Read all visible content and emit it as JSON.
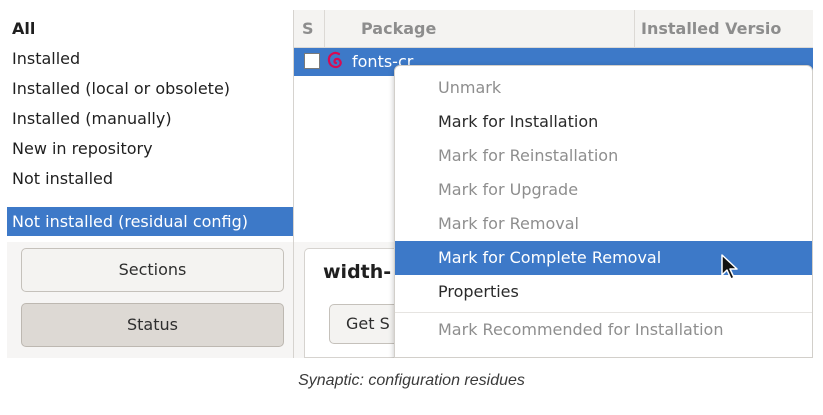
{
  "filters": {
    "items": [
      {
        "label": "All",
        "bold": true,
        "selected": false
      },
      {
        "label": "Installed",
        "bold": false,
        "selected": false
      },
      {
        "label": "Installed (local or obsolete)",
        "bold": false,
        "selected": false
      },
      {
        "label": "Installed (manually)",
        "bold": false,
        "selected": false
      },
      {
        "label": "New in repository",
        "bold": false,
        "selected": false
      },
      {
        "label": "Not installed",
        "bold": false,
        "selected": false
      },
      {
        "label": "Not installed (residual config)",
        "bold": false,
        "selected": true
      }
    ]
  },
  "panel_buttons": {
    "sections": "Sections",
    "status": "Status"
  },
  "package_list": {
    "columns": {
      "s": "S",
      "package": "Package",
      "installed_version": "Installed Versio"
    },
    "row": {
      "name": "fonts-cr",
      "checked": false,
      "icon": "debian-swirl-icon"
    }
  },
  "detail": {
    "title": "width-",
    "button": "Get S"
  },
  "context_menu": {
    "items": [
      {
        "label": "Unmark",
        "enabled": false,
        "highlighted": false
      },
      {
        "label": "Mark for Installation",
        "enabled": true,
        "highlighted": false
      },
      {
        "label": "Mark for Reinstallation",
        "enabled": false,
        "highlighted": false
      },
      {
        "label": "Mark for Upgrade",
        "enabled": false,
        "highlighted": false
      },
      {
        "label": "Mark for Removal",
        "enabled": false,
        "highlighted": false
      },
      {
        "label": "Mark for Complete Removal",
        "enabled": true,
        "highlighted": true
      },
      {
        "label": "Properties",
        "enabled": true,
        "highlighted": false
      },
      {
        "label": "Mark Recommended for Installation",
        "enabled": false,
        "highlighted": false
      }
    ]
  },
  "caption": "Synaptic: configuration residues",
  "colors": {
    "selection": "#3d79c8",
    "debian_red": "#d70a53",
    "disabled_text": "#8e8e8e"
  }
}
